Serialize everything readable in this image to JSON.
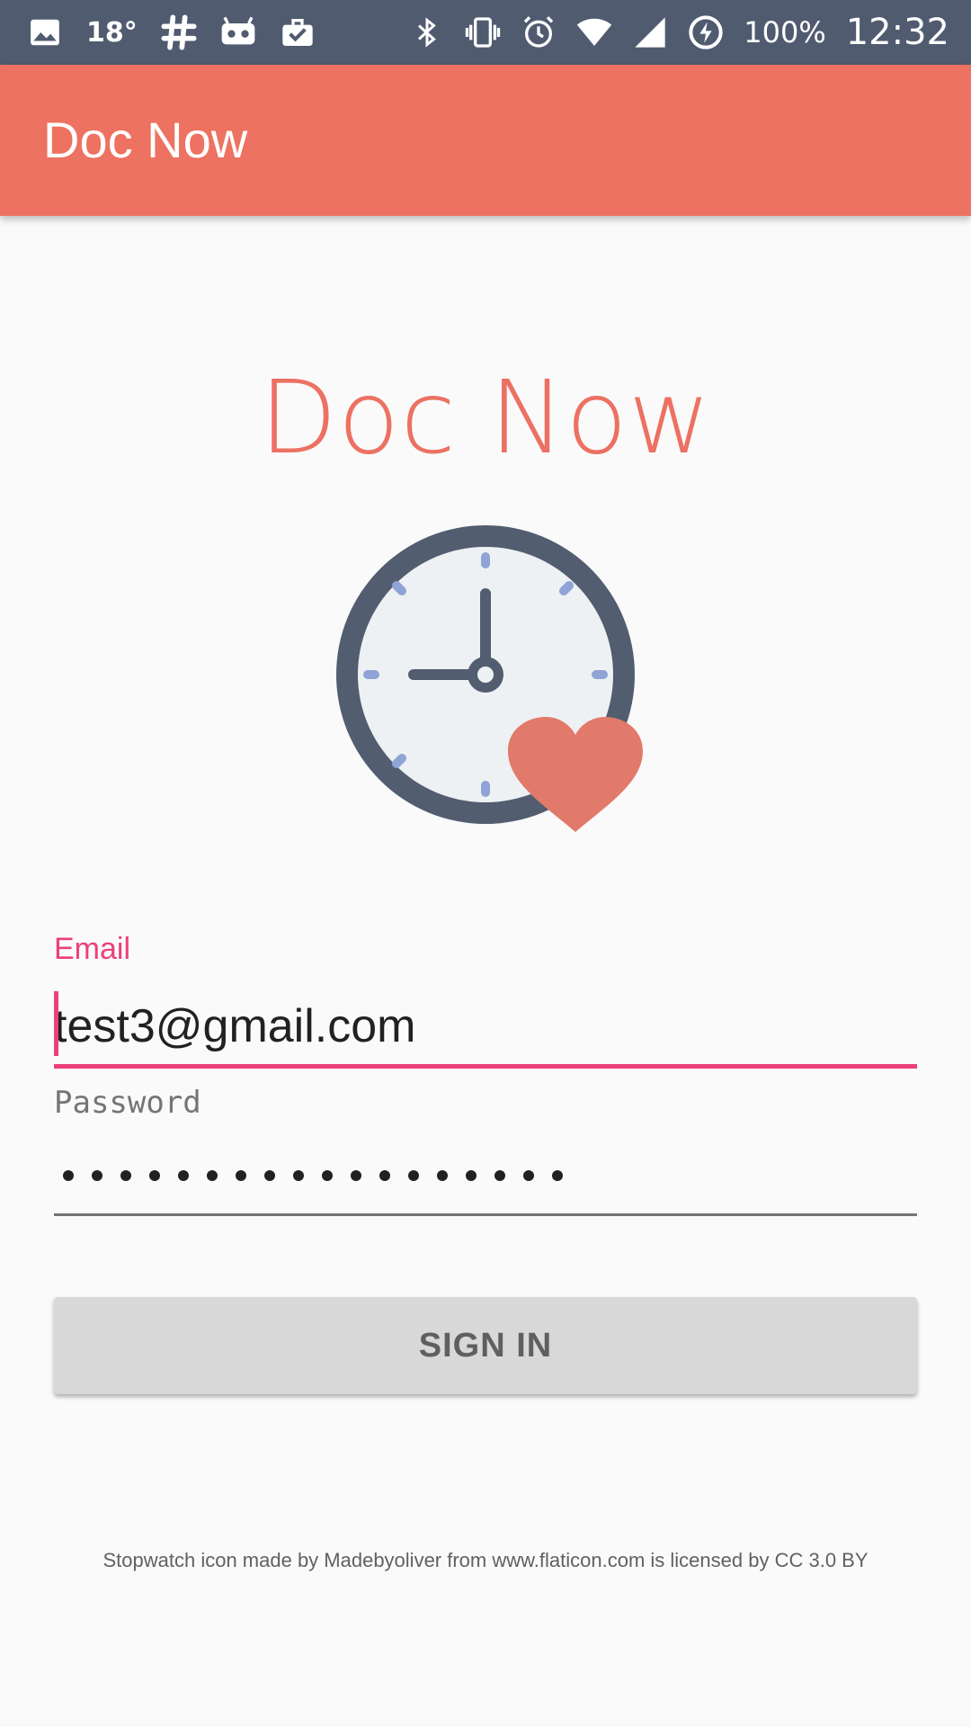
{
  "status_bar": {
    "temperature": "18°",
    "battery": "100%",
    "time": "12:32",
    "icons": [
      "image-icon",
      "slack-icon",
      "cardboard-icon",
      "briefcase-icon",
      "bluetooth-icon",
      "vibrate-icon",
      "alarm-icon",
      "wifi-icon",
      "signal-icon",
      "battery-saver-icon"
    ]
  },
  "app_bar": {
    "title": "Doc Now",
    "color": "#ed7261"
  },
  "logo": {
    "text": "Doc Now",
    "color": "#ec7163",
    "icon": "clock-heart-icon"
  },
  "form": {
    "email": {
      "label": "Email",
      "value": "test3@gmail.com",
      "accent": "#ec407a"
    },
    "password": {
      "label": "Password",
      "masked_length": 18
    },
    "sign_in_label": "SIGN IN"
  },
  "attribution": "Stopwatch icon made by Madebyoliver from www.flaticon.com is licensed by CC 3.0 BY"
}
